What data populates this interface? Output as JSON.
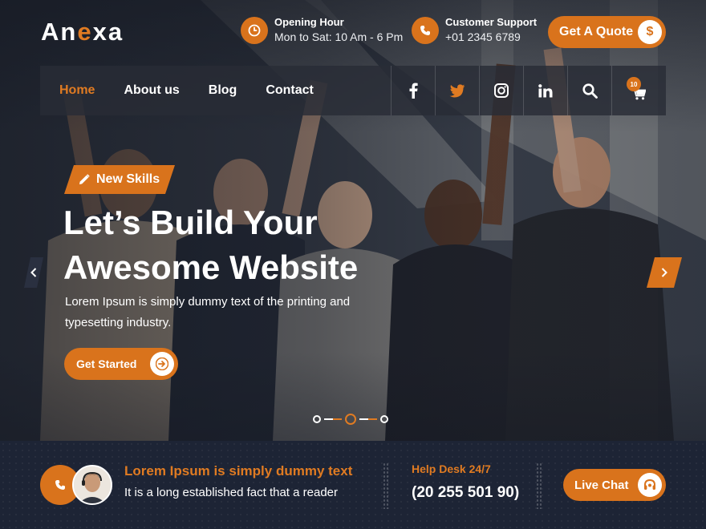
{
  "brand": {
    "logo_start": "An",
    "logo_accent": "e",
    "logo_end": "xa"
  },
  "header": {
    "opening": {
      "icon": "clock-icon",
      "title": "Opening Hour",
      "value": "Mon to Sat: 10 Am - 6 Pm"
    },
    "support": {
      "icon": "phone-icon",
      "title": "Customer Support",
      "value": "+01 2345 6789"
    },
    "quote_button": {
      "label": "Get A Quote",
      "icon": "dollar-icon"
    }
  },
  "nav": {
    "links": [
      {
        "label": "Home",
        "active": true
      },
      {
        "label": "About us",
        "active": false
      },
      {
        "label": "Blog",
        "active": false
      },
      {
        "label": "Contact",
        "active": false
      }
    ],
    "icons": [
      "facebook-icon",
      "twitter-icon",
      "instagram-icon",
      "linkedin-icon",
      "search-icon",
      "cart-icon"
    ],
    "cart_count": "10"
  },
  "hero": {
    "tag": "New Skills",
    "headline_line1": "Let’s Build Your",
    "headline_line2": "Awesome Website",
    "subtitle": "Lorem Ipsum is simply dummy text of the printing and typesetting industry.",
    "cta": "Get Started",
    "slide_count": 3,
    "active_slide": 2
  },
  "bottom": {
    "title": "Lorem Ipsum is simply dummy text",
    "text": "It is a long established fact that a reader",
    "help_label": "Help Desk 24/7",
    "help_number": "(20 255 501 90)",
    "chat_button": "Live Chat"
  },
  "colors": {
    "accent": "#d9731c",
    "dark": "#1d2435",
    "twitter_orange": "#e07b22"
  }
}
